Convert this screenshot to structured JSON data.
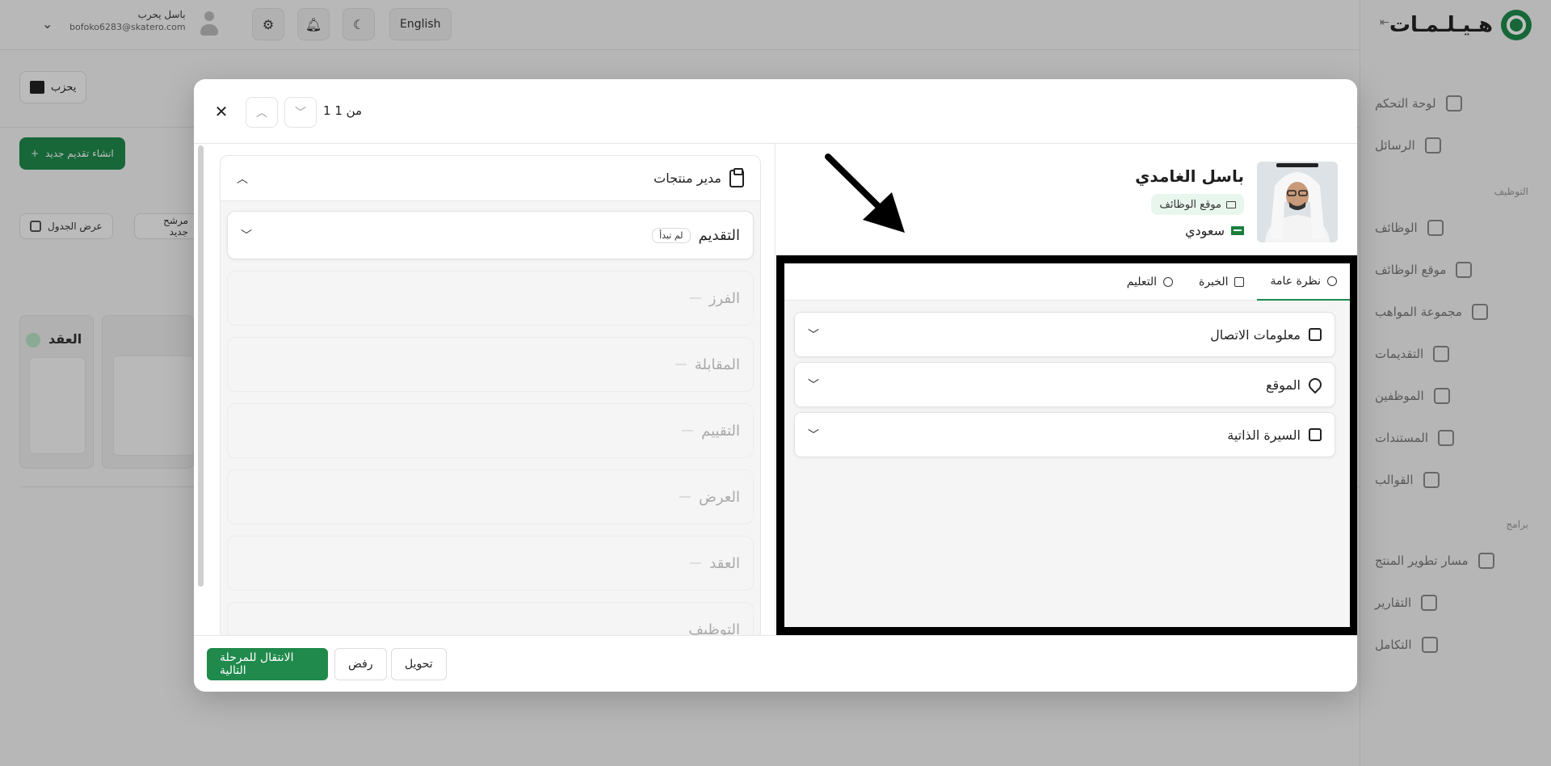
{
  "app": {
    "logo_text": "هـيـلـمـات",
    "user_name": "باسل يحرب",
    "user_email": "bofoko6283@skatero.com",
    "language_button": "English"
  },
  "sidebar": {
    "items": [
      {
        "label": "لوحة التحكم",
        "icon": "dashboard-icon"
      },
      {
        "label": "الرسائل",
        "icon": "mail-icon"
      },
      {
        "section": "التوظيف"
      },
      {
        "label": "الوظائف",
        "icon": "briefcase-icon"
      },
      {
        "label": "موقع الوظائف",
        "icon": "laptop-icon"
      },
      {
        "label": "مجموعة المواهب",
        "icon": "plus-circle-icon"
      },
      {
        "label": "التقديمات",
        "icon": "store-icon"
      },
      {
        "label": "الموظفين",
        "icon": "user-icon"
      },
      {
        "label": "المستندات",
        "icon": "file-icon"
      },
      {
        "label": "القوالب",
        "icon": "template-icon"
      },
      {
        "section": "برامج"
      },
      {
        "label": "مسار تطوير المنتج",
        "icon": "flame-icon"
      },
      {
        "label": "التقارير",
        "icon": "filter-icon"
      },
      {
        "label": "التكامل",
        "icon": "link-icon"
      }
    ]
  },
  "page": {
    "department_button": "يحزب",
    "create_button": "انشاء تقديم جديد",
    "view_table": "عرض الجدول",
    "new_candidate": "مرشح جديد",
    "contract_column": "العقد"
  },
  "modal": {
    "pager": "1 من 1",
    "job": {
      "title": "مدير منتجات",
      "stages": [
        {
          "name": "التقديم",
          "badge": "لم تبدأ"
        },
        {
          "name": "الفرز"
        },
        {
          "name": "المقابلة"
        },
        {
          "name": "التقييم"
        },
        {
          "name": "العرض"
        },
        {
          "name": "العقد"
        },
        {
          "name": "التوظيف"
        }
      ]
    },
    "candidate": {
      "name": "باسل الغامدي",
      "source": "موقع الوظائف",
      "nationality": "سعودي"
    },
    "tabs": [
      "نظرة عامة",
      "الخبرة",
      "التعليم"
    ],
    "sections": [
      "معلومات الاتصال",
      "الموقع",
      "السيرة الذاتية"
    ],
    "footer": {
      "next_stage": "الانتقال للمرحلة التالية",
      "reject": "رفض",
      "transfer": "تحويل"
    }
  },
  "colors": {
    "accent": "#1f8a4c",
    "badge_bg": "#e9f6ee",
    "highlight": "#000000"
  }
}
